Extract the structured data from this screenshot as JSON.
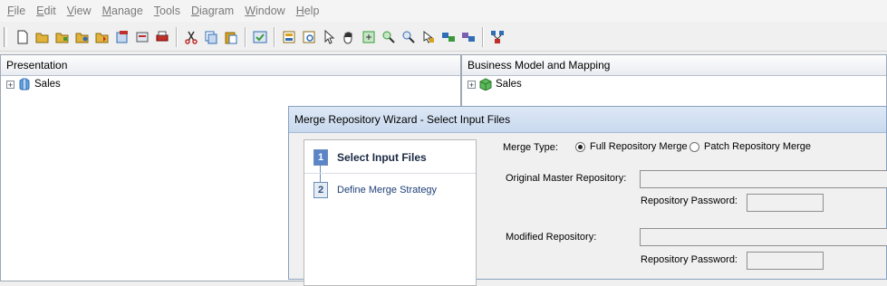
{
  "menu": {
    "items": [
      {
        "accel": "F",
        "rest": "ile"
      },
      {
        "accel": "E",
        "rest": "dit"
      },
      {
        "accel": "V",
        "rest": "iew"
      },
      {
        "accel": "M",
        "rest": "anage"
      },
      {
        "accel": "T",
        "rest": "ools"
      },
      {
        "accel": "D",
        "rest": "iagram"
      },
      {
        "accel": "W",
        "rest": "indow"
      },
      {
        "accel": "H",
        "rest": "elp"
      }
    ]
  },
  "toolbar": {
    "icons": [
      "new-file-icon",
      "open-icon",
      "open-offline-icon",
      "open-online-icon",
      "import-icon",
      "copy-repository-icon",
      "export-icon",
      "print-icon",
      "cut-icon",
      "copy-icon",
      "paste-icon",
      "check-consistency-icon",
      "browse-icon",
      "query-repository-icon",
      "pointer-icon",
      "pan-icon",
      "zoom-box-icon",
      "zoom-in-icon",
      "zoom-out-icon",
      "select-icon",
      "link-icon",
      "relationships-icon",
      "diagram-icon"
    ],
    "colors": {
      "primary": "#d9a21c",
      "accent": "#2f6db5",
      "danger": "#c0302a",
      "green": "#3a9a3a"
    }
  },
  "presentation_pane": {
    "title": "Presentation",
    "tree": [
      {
        "label": "Sales",
        "expander": "+"
      }
    ]
  },
  "bmm_pane": {
    "title": "Business Model and Mapping",
    "tree": [
      {
        "label": "Sales",
        "expander": "+"
      }
    ]
  },
  "wizard": {
    "title": "Merge Repository Wizard - Select Input Files",
    "steps": [
      {
        "number": "1",
        "label": "Select Input Files",
        "active": true
      },
      {
        "number": "2",
        "label": "Define Merge Strategy",
        "active": false
      }
    ],
    "merge_type_label": "Merge Type:",
    "merge_options": [
      {
        "label": "Full Repository Merge",
        "checked": true
      },
      {
        "label": "Patch Repository Merge",
        "checked": false
      }
    ],
    "original_master_label": "Original Master Repository:",
    "original_master_value": "",
    "password_label_1": "Repository Password:",
    "password_value_1": "",
    "modified_label": "Modified Repository:",
    "modified_value": "",
    "password_label_2": "Repository Password:",
    "password_value_2": ""
  }
}
